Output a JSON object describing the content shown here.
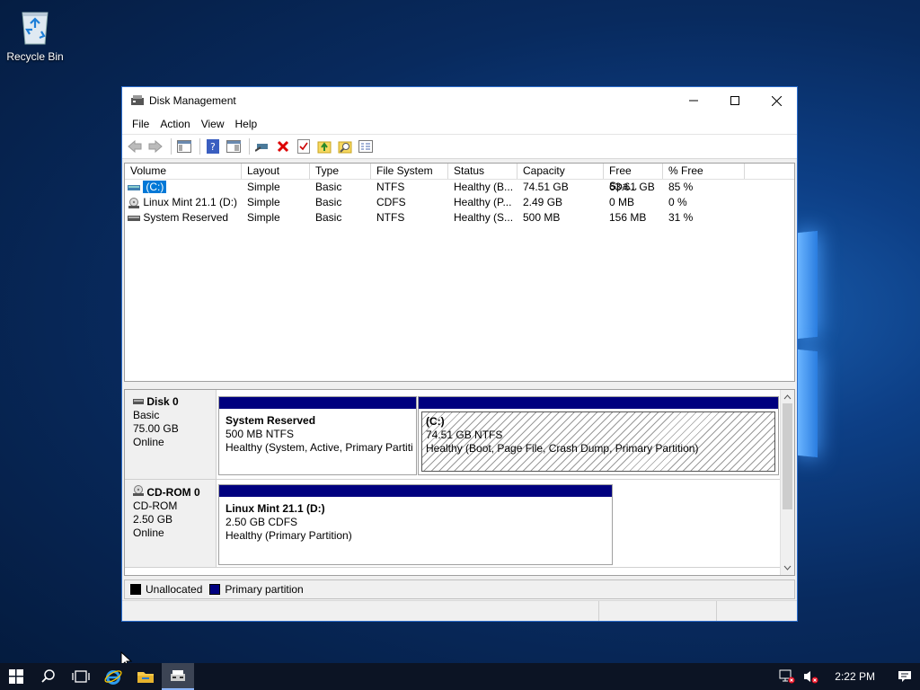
{
  "desktop": {
    "recycle_bin_label": "Recycle Bin"
  },
  "window": {
    "title": "Disk Management",
    "menu": [
      "File",
      "Action",
      "View",
      "Help"
    ],
    "toolbar_icons": [
      "back-icon",
      "forward-icon",
      "console-tree-icon",
      "help-icon",
      "properties-icon",
      "connect-icon",
      "delete-icon",
      "check-icon",
      "import-icon",
      "search-icon",
      "settings-icon"
    ]
  },
  "volumes": {
    "columns": [
      "Volume",
      "Layout",
      "Type",
      "File System",
      "Status",
      "Capacity",
      "Free Spa...",
      "% Free"
    ],
    "rows": [
      {
        "volume": "(C:)",
        "layout": "Simple",
        "type": "Basic",
        "fs": "NTFS",
        "status": "Healthy (B...",
        "capacity": "74.51 GB",
        "free": "63.61 GB",
        "pct": "85 %",
        "selected": true
      },
      {
        "volume": "Linux Mint 21.1 (D:)",
        "layout": "Simple",
        "type": "Basic",
        "fs": "CDFS",
        "status": "Healthy (P...",
        "capacity": "2.49 GB",
        "free": "0 MB",
        "pct": "0 %",
        "selected": false
      },
      {
        "volume": "System Reserved",
        "layout": "Simple",
        "type": "Basic",
        "fs": "NTFS",
        "status": "Healthy (S...",
        "capacity": "500 MB",
        "free": "156 MB",
        "pct": "31 %",
        "selected": false
      }
    ]
  },
  "disks": {
    "disk0": {
      "name": "Disk 0",
      "type": "Basic",
      "size": "75.00 GB",
      "state": "Online",
      "partitions": [
        {
          "name": "System Reserved",
          "detail": "500 MB NTFS",
          "status": "Healthy (System, Active, Primary Partiti"
        },
        {
          "name": "(C:)",
          "detail": "74.51 GB NTFS",
          "status": "Healthy (Boot, Page File, Crash Dump, Primary Partition)"
        }
      ]
    },
    "cdrom0": {
      "name": "CD-ROM 0",
      "type": "CD-ROM",
      "size": "2.50 GB",
      "state": "Online",
      "partition": {
        "name": "Linux Mint 21.1  (D:)",
        "detail": "2.50 GB CDFS",
        "status": "Healthy (Primary Partition)"
      }
    }
  },
  "legend": {
    "unallocated": "Unallocated",
    "primary": "Primary partition",
    "colors": {
      "unallocated": "#000000",
      "primary": "#00007f"
    }
  },
  "taskbar": {
    "clock": "2:22 PM"
  }
}
